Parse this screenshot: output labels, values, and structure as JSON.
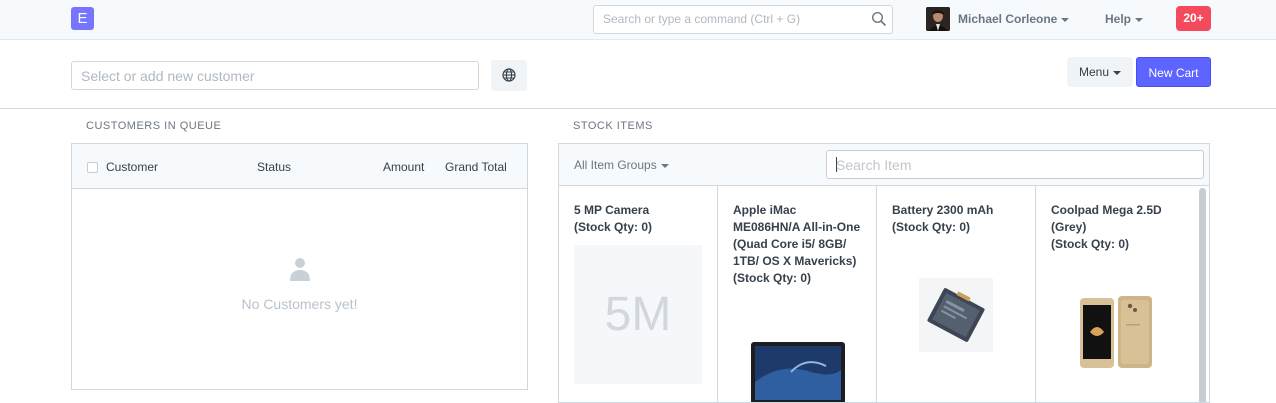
{
  "navbar": {
    "logo_letter": "E",
    "search_placeholder": "Search or type a command (Ctrl + G)",
    "user_name": "Michael Corleone",
    "help_label": "Help",
    "notifications": "20+"
  },
  "header": {
    "customer_placeholder": "Select or add new customer",
    "menu_label": "Menu",
    "new_cart_label": "New Cart"
  },
  "queue": {
    "section_title": "CUSTOMERS IN QUEUE",
    "columns": [
      "Customer",
      "Status",
      "Amount",
      "Grand Total"
    ],
    "empty_text": "No Customers yet!"
  },
  "stock": {
    "section_title": "STOCK ITEMS",
    "group_filter": "All Item Groups",
    "search_placeholder": "Search Item",
    "items": [
      {
        "name": "5 MP Camera",
        "qty": "(Stock Qty: 0)",
        "image_text": "5M"
      },
      {
        "name": "Apple iMac ME086HN/A All-in-One (Quad Core i5/ 8GB/ 1TB/ OS X Mavericks)",
        "qty": "(Stock Qty: 0)"
      },
      {
        "name": "Battery 2300 mAh",
        "qty": "(Stock Qty: 0)"
      },
      {
        "name": "Coolpad Mega 2.5D (Grey)",
        "qty": "(Stock Qty: 0)"
      }
    ]
  },
  "colors": {
    "brand": "#7575ff",
    "primary_button": "#5e64ff",
    "notification": "#f54a5d"
  }
}
